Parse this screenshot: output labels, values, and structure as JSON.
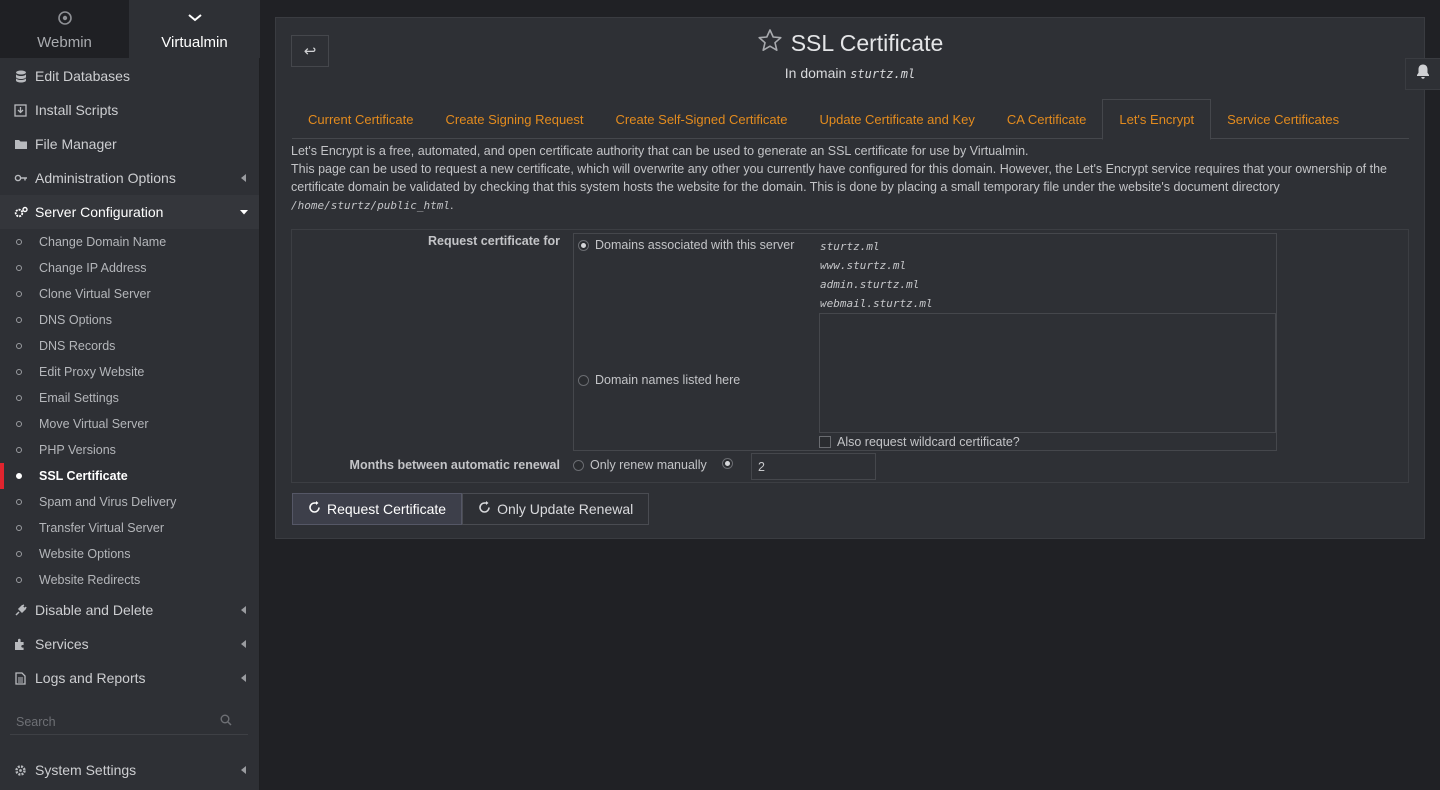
{
  "switcher": {
    "webmin_label": "Webmin",
    "virtualmin_label": "Virtualmin"
  },
  "sidebar": {
    "items": [
      {
        "label": "Edit Databases"
      },
      {
        "label": "Install Scripts"
      },
      {
        "label": "File Manager"
      },
      {
        "label": "Administration Options"
      },
      {
        "label": "Server Configuration"
      }
    ],
    "subitems": [
      "Change Domain Name",
      "Change IP Address",
      "Clone Virtual Server",
      "DNS Options",
      "DNS Records",
      "Edit Proxy Website",
      "Email Settings",
      "Move Virtual Server",
      "PHP Versions",
      "SSL Certificate",
      "Spam and Virus Delivery",
      "Transfer Virtual Server",
      "Website Options",
      "Website Redirects"
    ],
    "items_after": [
      {
        "label": "Disable and Delete"
      },
      {
        "label": "Services"
      },
      {
        "label": "Logs and Reports"
      }
    ],
    "search_placeholder": "Search",
    "system_settings": "System Settings"
  },
  "header": {
    "title": "SSL Certificate",
    "subtitle_prefix": "In domain",
    "subtitle_domain": "sturtz.ml"
  },
  "tabs": [
    "Current Certificate",
    "Create Signing Request",
    "Create Self-Signed Certificate",
    "Update Certificate and Key",
    "CA Certificate",
    "Let's Encrypt",
    "Service Certificates"
  ],
  "intro": {
    "line1": "Let's Encrypt is a free, automated, and open certificate authority that can be used to generate an SSL certificate for use by Virtualmin.",
    "line2": "This page can be used to request a new certificate, which will overwrite any other you currently have configured for this domain. However, the Let's Encrypt service requires that your ownership of the certificate domain be validated by checking that this system hosts the website for the domain. This is done by placing a small temporary file under the website's document directory",
    "path": "/home/sturtz/public_html",
    "path_suffix": "."
  },
  "form": {
    "request_label": "Request certificate for",
    "opt_associated": "Domains associated with this server",
    "domains": [
      "sturtz.ml",
      "www.sturtz.ml",
      "admin.sturtz.ml",
      "webmail.sturtz.ml"
    ],
    "opt_listed": "Domain names listed here",
    "wildcard_label": "Also request wildcard certificate?",
    "months_label": "Months between automatic renewal",
    "opt_manual": "Only renew manually",
    "months_value": "2"
  },
  "buttons": {
    "request": "Request Certificate",
    "renewal": "Only Update Renewal"
  }
}
